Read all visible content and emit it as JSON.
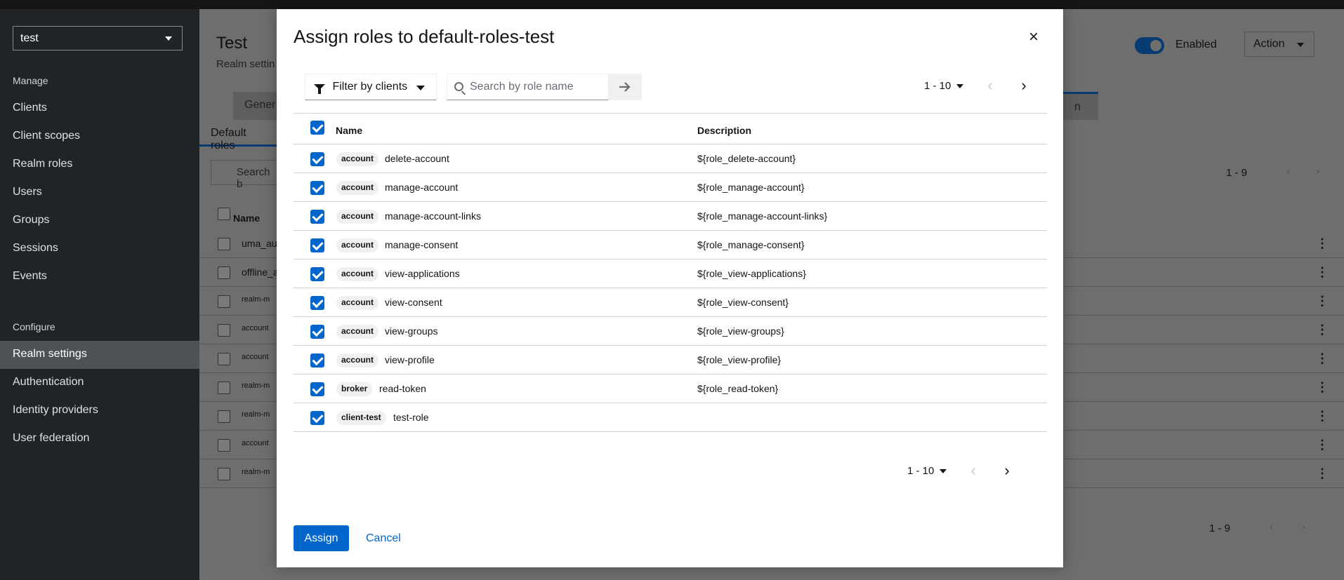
{
  "app": {
    "realm_selector": "test",
    "nav_manage_heading": "Manage",
    "nav_manage": [
      "Clients",
      "Client scopes",
      "Realm roles",
      "Users",
      "Groups",
      "Sessions",
      "Events"
    ],
    "nav_configure_heading": "Configure",
    "nav_configure": [
      "Realm settings",
      "Authentication",
      "Identity providers",
      "User federation"
    ],
    "active_nav": "Realm settings"
  },
  "background_page": {
    "title": "Test",
    "subtitle": "Realm settin",
    "enabled_label": "Enabled",
    "action_label": "Action",
    "tab_partial": "Gener",
    "tab_partial_right": "n",
    "subtab": "Default roles",
    "search_partial": "Search b",
    "name_header": "Name",
    "row_fragments": [
      "uma_au",
      "offline_a",
      "realm-m",
      "account",
      "account",
      "realm-m",
      "realm-m",
      "account",
      "realm-m"
    ],
    "pager_top": "1 - 9",
    "pager_bottom": "1 - 9"
  },
  "modal": {
    "title": "Assign roles to default-roles-test",
    "filter_label": "Filter by clients",
    "search_placeholder": "Search by role name",
    "pager_top": "1 - 10",
    "pager_bottom": "1 - 10",
    "col_name": "Name",
    "col_description": "Description",
    "rows": [
      {
        "client": "account",
        "name": "delete-account",
        "description": "${role_delete-account}"
      },
      {
        "client": "account",
        "name": "manage-account",
        "description": "${role_manage-account}"
      },
      {
        "client": "account",
        "name": "manage-account-links",
        "description": "${role_manage-account-links}"
      },
      {
        "client": "account",
        "name": "manage-consent",
        "description": "${role_manage-consent}"
      },
      {
        "client": "account",
        "name": "view-applications",
        "description": "${role_view-applications}"
      },
      {
        "client": "account",
        "name": "view-consent",
        "description": "${role_view-consent}"
      },
      {
        "client": "account",
        "name": "view-groups",
        "description": "${role_view-groups}"
      },
      {
        "client": "account",
        "name": "view-profile",
        "description": "${role_view-profile}"
      },
      {
        "client": "broker",
        "name": "read-token",
        "description": "${role_read-token}"
      },
      {
        "client": "client-test",
        "name": "test-role",
        "description": ""
      }
    ],
    "assign_label": "Assign",
    "cancel_label": "Cancel"
  },
  "colors": {
    "primary": "#0066cc",
    "sidebar_bg": "#212427",
    "overlay_bg": "#6e6e6e"
  }
}
